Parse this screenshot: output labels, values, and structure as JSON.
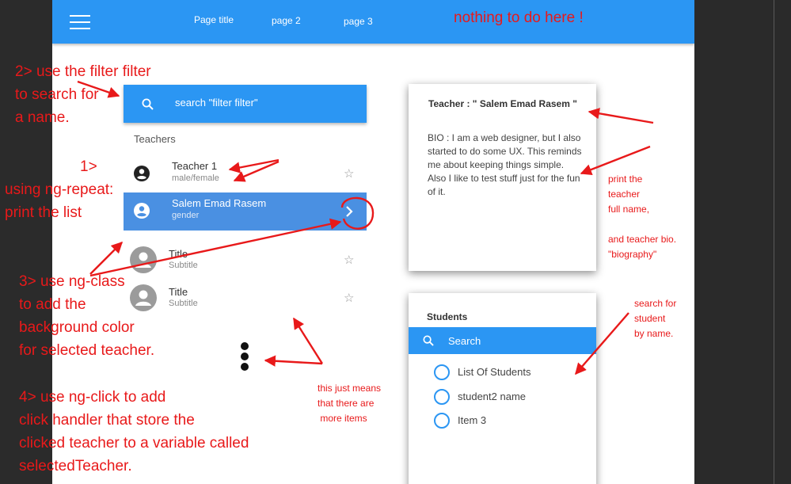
{
  "topbar": {
    "tabs": [
      "Page title",
      "page 2",
      "page 3"
    ],
    "note": "nothing to do here !"
  },
  "left": {
    "search_label": "search \"filter filter\"",
    "section_title": "Teachers",
    "teachers": [
      {
        "name": "Teacher 1",
        "subtitle": "male/female"
      },
      {
        "name": "Salem Emad Rasem",
        "subtitle": "gender"
      },
      {
        "name": "Title",
        "subtitle": "Subtitle"
      },
      {
        "name": "Title",
        "subtitle": "Subtitle"
      }
    ]
  },
  "teacher_card": {
    "heading": "Teacher : \" Salem Emad Rasem \"",
    "bio": "BIO : I am a web designer, but I also started to do some UX. This reminds me about keeping things simple. Also I like to test stuff just for the fun of it."
  },
  "students_card": {
    "heading": "Students",
    "search_label": "Search",
    "items": [
      "List Of Students",
      "student2 name",
      "Item 3"
    ]
  },
  "annotations": {
    "filter": [
      "2> use the filter filter",
      "to search for",
      "a name."
    ],
    "repeat": [
      "1>",
      "using ng-repeat:",
      "print the list"
    ],
    "ngclass": [
      "3> use ng-class",
      "to add the",
      "background color",
      "for selected teacher."
    ],
    "ngclick": [
      "4> use ng-click to add",
      "click handler that store the",
      "clicked teacher to a variable called",
      "selectedTeacher."
    ],
    "more_items": [
      "this just means",
      "that there are",
      " more items"
    ],
    "print_teacher": [
      "print the",
      "teacher",
      "full name,",
      "",
      "and teacher bio.",
      "\"biography\""
    ],
    "search_student": [
      "search for",
      "student",
      "by name."
    ]
  },
  "colors": {
    "accent": "#2b96f3",
    "selected": "#4a90e2",
    "annotation": "#e8191a"
  }
}
